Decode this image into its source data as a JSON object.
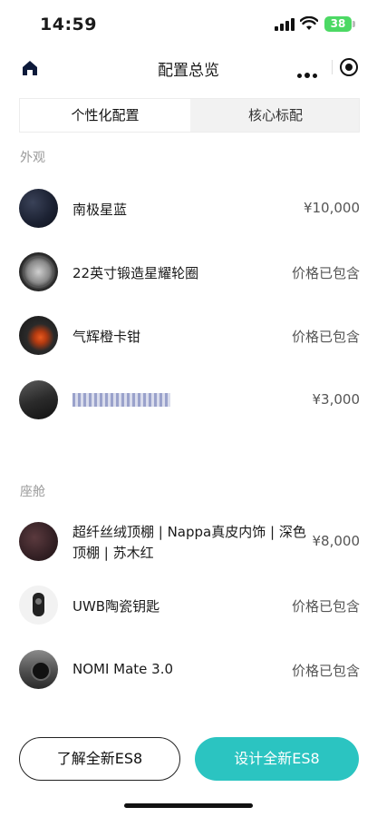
{
  "status_bar": {
    "time": "14:59",
    "battery": "38"
  },
  "nav": {
    "title": "配置总览",
    "icons": [
      "home-icon",
      "more-icon",
      "target-icon"
    ]
  },
  "tabs": [
    {
      "label": "个性化配置",
      "active": true
    },
    {
      "label": "核心标配",
      "active": false
    }
  ],
  "sections": {
    "exterior": {
      "title": "外观",
      "items": [
        {
          "name": "南极星蓝",
          "price": "¥10,000",
          "thumb": "blue-paint-swatch"
        },
        {
          "name": "22英寸锻造星耀轮圈",
          "price": "价格已包含",
          "thumb": "wheel-rim"
        },
        {
          "name": "气辉橙卡钳",
          "price": "价格已包含",
          "thumb": "brake-caliper"
        },
        {
          "name": "",
          "price": "¥3,000",
          "thumb": "dark-trim"
        }
      ]
    },
    "cabin": {
      "title": "座舱",
      "items": [
        {
          "name": "超纤丝绒顶棚 | Nappa真皮内饰 | 深色顶棚 | 苏木红",
          "price": "¥8,000",
          "thumb": "red-interior"
        },
        {
          "name": "UWB陶瓷钥匙",
          "price": "价格已包含",
          "thumb": "ceramic-key"
        },
        {
          "name": "NOMI Mate 3.0",
          "price": "价格已包含",
          "thumb": "nomi-device"
        }
      ]
    }
  },
  "buttons": {
    "learn": "了解全新ES8",
    "design": "设计全新ES8"
  },
  "colors": {
    "accent": "#2bc4c1",
    "battery": "#4cd964"
  }
}
